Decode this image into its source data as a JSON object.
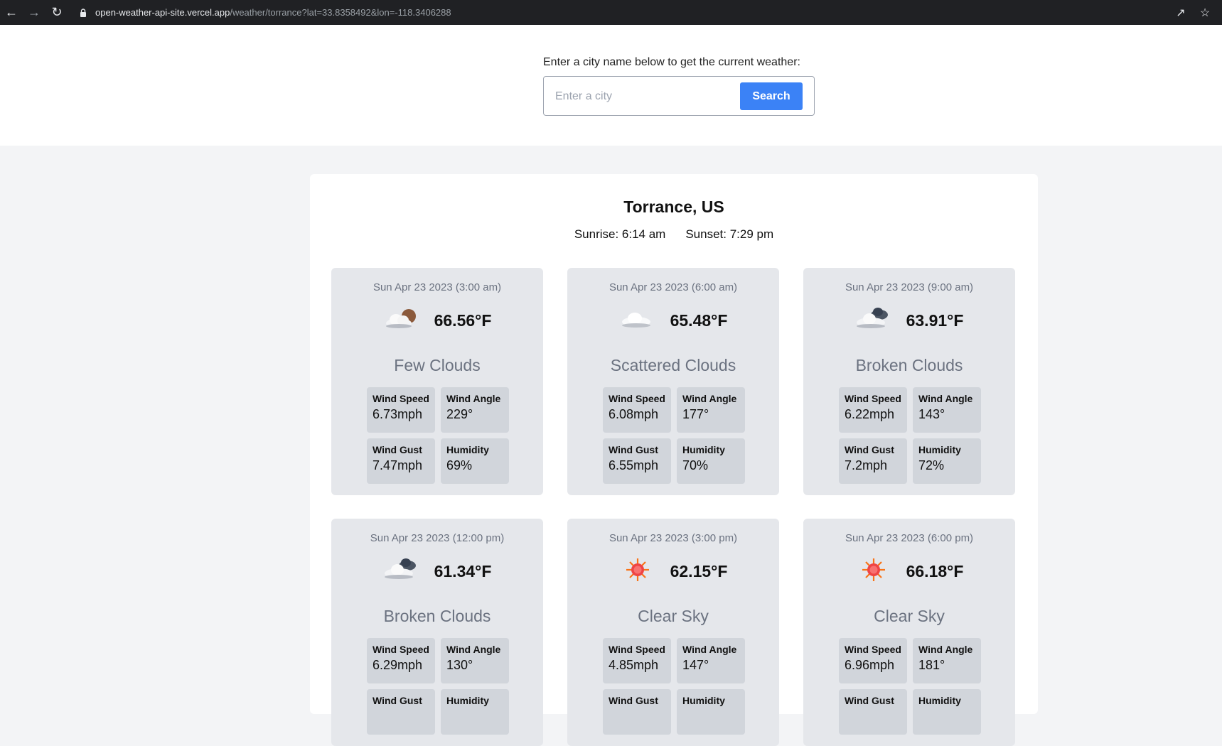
{
  "browser": {
    "url_host": "open-weather-api-site.vercel.app",
    "url_path": "/weather/torrance?lat=33.8358492&lon=-118.3406288"
  },
  "search": {
    "label": "Enter a city name below to get the current weather:",
    "placeholder": "Enter a city",
    "value": "",
    "button_label": "Search"
  },
  "location": {
    "title": "Torrance, US",
    "sunrise": "Sunrise: 6:14 am",
    "sunset": "Sunset: 7:29 pm"
  },
  "stat_labels": {
    "wind_speed": "Wind Speed",
    "wind_angle": "Wind Angle",
    "wind_gust": "Wind Gust",
    "humidity": "Humidity"
  },
  "forecasts": [
    {
      "date": "Sun Apr 23 2023 (3:00 am)",
      "icon": "few-clouds-night-icon",
      "temp": "66.56°F",
      "desc": "Few Clouds",
      "wind_speed": "6.73mph",
      "wind_angle": "229°",
      "wind_gust": "7.47mph",
      "humidity": "69%"
    },
    {
      "date": "Sun Apr 23 2023 (6:00 am)",
      "icon": "scattered-clouds-icon",
      "temp": "65.48°F",
      "desc": "Scattered Clouds",
      "wind_speed": "6.08mph",
      "wind_angle": "177°",
      "wind_gust": "6.55mph",
      "humidity": "70%"
    },
    {
      "date": "Sun Apr 23 2023 (9:00 am)",
      "icon": "broken-clouds-icon",
      "temp": "63.91°F",
      "desc": "Broken Clouds",
      "wind_speed": "6.22mph",
      "wind_angle": "143°",
      "wind_gust": "7.2mph",
      "humidity": "72%"
    },
    {
      "date": "Sun Apr 23 2023 (12:00 pm)",
      "icon": "broken-clouds-icon",
      "temp": "61.34°F",
      "desc": "Broken Clouds",
      "wind_speed": "6.29mph",
      "wind_angle": "130°",
      "wind_gust": "",
      "humidity": ""
    },
    {
      "date": "Sun Apr 23 2023 (3:00 pm)",
      "icon": "clear-sky-sun-icon",
      "temp": "62.15°F",
      "desc": "Clear Sky",
      "wind_speed": "4.85mph",
      "wind_angle": "147°",
      "wind_gust": "",
      "humidity": ""
    },
    {
      "date": "Sun Apr 23 2023 (6:00 pm)",
      "icon": "clear-sky-sun-icon",
      "temp": "66.18°F",
      "desc": "Clear Sky",
      "wind_speed": "6.96mph",
      "wind_angle": "181°",
      "wind_gust": "",
      "humidity": ""
    }
  ]
}
